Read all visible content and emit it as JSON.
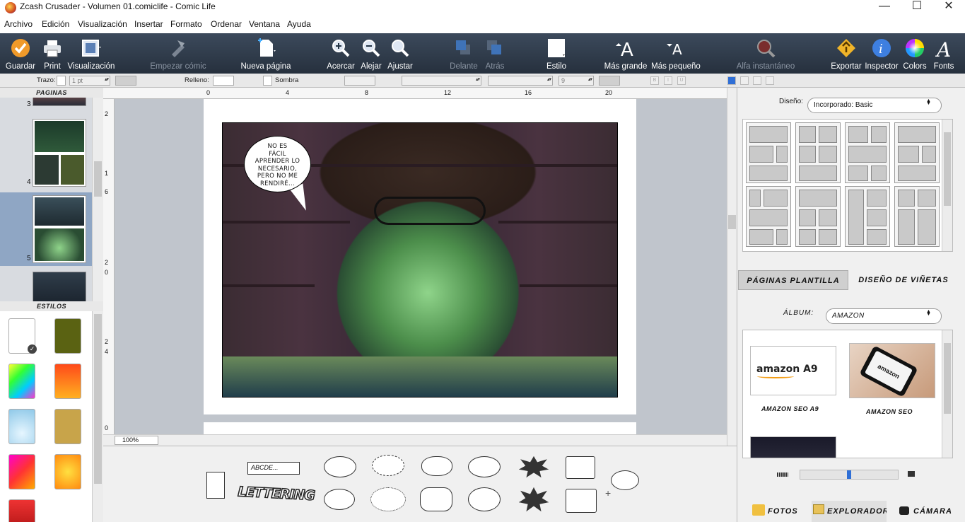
{
  "window": {
    "title": "Zcash Crusader - Volumen 01.comiclife - Comic Life"
  },
  "menu": [
    "Archivo",
    "Edición",
    "Visualización",
    "Insertar",
    "Formato",
    "Ordenar",
    "Ventana",
    "Ayuda"
  ],
  "toolbar": {
    "save": "Guardar",
    "print": "Print",
    "view": "Visualización",
    "start_comic": "Empezar cómic",
    "new_page": "Nueva página",
    "zoom_in": "Acercar",
    "zoom_out": "Alejar",
    "fit": "Ajustar",
    "front": "Delante",
    "back": "Atrás",
    "style": "Estilo",
    "bigger": "Más grande",
    "smaller": "Más pequeño",
    "instant_alpha": "Alfa instantáneo",
    "export": "Exportar",
    "inspector": "Inspector",
    "colors": "Colors",
    "fonts": "Fonts"
  },
  "formatbar": {
    "stroke_label": "Trazo:",
    "stroke_width": "1 pt",
    "fill_label": "Relleno:",
    "shadow_label": "Sombra",
    "font_size": "9"
  },
  "left_panel": {
    "pages_header": "PAGINAS",
    "page_numbers": [
      "3",
      "4",
      "5"
    ],
    "styles_header": "ESTILOS"
  },
  "rulers": {
    "top": [
      "0",
      "4",
      "8",
      "12",
      "16",
      "20"
    ],
    "left": [
      "2",
      "1",
      "6",
      "2",
      "0",
      "2",
      "4",
      "0"
    ]
  },
  "comic": {
    "bubble_text": [
      "NO ES",
      "FÁCIL",
      "APRENDER LO",
      "NECESARIO,",
      "PERO NO ME",
      "RENDIRÉ..."
    ]
  },
  "zoom": "100%",
  "palette": {
    "caption_text": "ABCDE...",
    "lettering_text": "LETTERING"
  },
  "right_panel": {
    "design_label": "Diseño:",
    "design_value": "Incorporado: Basic",
    "tab_templates": "PÁGINAS PLANTILLA",
    "tab_panels": "DISEÑO DE VIÑETAS",
    "album_label": "ÁLBUM:",
    "album_value": "AMAZON",
    "photos": [
      {
        "caption": "AMAZON SEO A9",
        "logo": "amazon A9"
      },
      {
        "caption": "AMAZON SEO",
        "logo": "amazon"
      }
    ],
    "bottom_tabs": [
      "FOTOS",
      "EXPLORADOR",
      "CÁMARA"
    ]
  },
  "colors": {
    "toolbar_bg": "#2f3b4b",
    "accent_blue": "#2f6fd6",
    "selection": "#8fa6c4"
  }
}
